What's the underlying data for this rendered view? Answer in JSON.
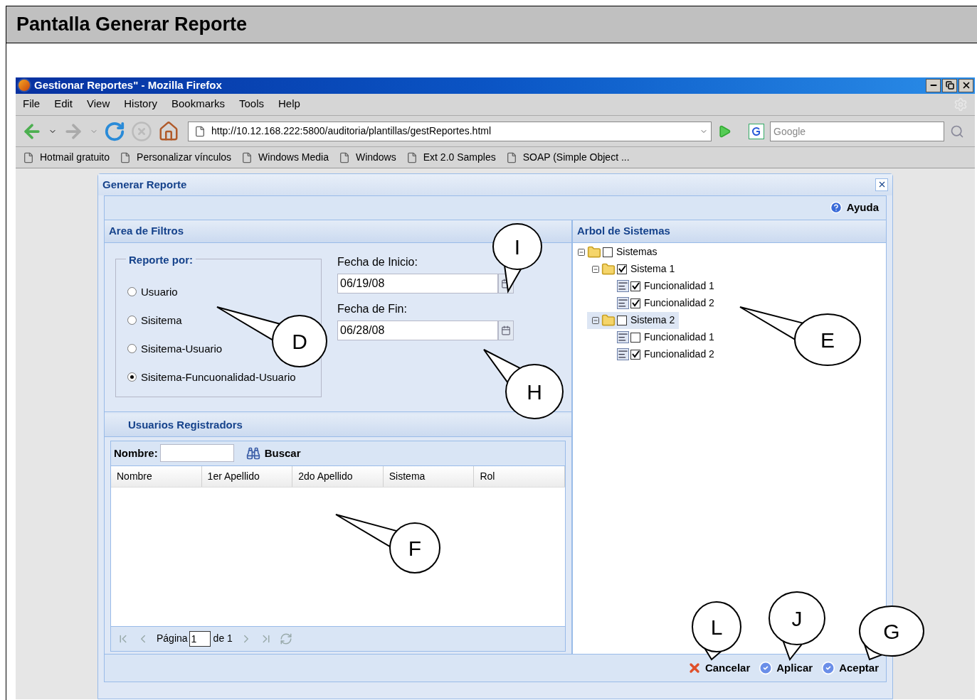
{
  "document": {
    "title": "Pantalla Generar Reporte"
  },
  "browser": {
    "title": "Gestionar Reportes\" - Mozilla Firefox",
    "menu": [
      "File",
      "Edit",
      "View",
      "History",
      "Bookmarks",
      "Tools",
      "Help"
    ],
    "url": "http://10.12.168.222:5800/auditoria/plantillas/gestReportes.html",
    "search": {
      "placeholder": "Google"
    },
    "bookmarks": [
      "Hotmail gratuito",
      "Personalizar vínculos",
      "Windows Media",
      "Windows",
      "Ext 2.0 Samples",
      "SOAP (Simple Object ..."
    ]
  },
  "dialog": {
    "title": "Generar Reporte",
    "help": "Ayuda",
    "filters": {
      "title": "Area de Filtros",
      "group": "Reporte por:",
      "options": [
        {
          "label": "Usuario",
          "selected": false
        },
        {
          "label": "Sisitema",
          "selected": false
        },
        {
          "label": "Sisitema-Usuario",
          "selected": false
        },
        {
          "label": "Sisitema-Funcuonalidad-Usuario",
          "selected": true
        }
      ],
      "start_label": "Fecha de Inicio:",
      "start_value": "06/19/08",
      "end_label": "Fecha de Fin:",
      "end_value": "06/28/08"
    },
    "users": {
      "title": "Usuarios Registradors",
      "search_label": "Nombre:",
      "search_button": "Buscar",
      "columns": [
        "Nombre",
        "1er Apellido",
        "2do Apellido",
        "Sistema",
        "Rol"
      ],
      "pager": {
        "page_label": "Página",
        "page": "1",
        "total": "de 1"
      }
    },
    "tree": {
      "title": "Arbol de Sistemas",
      "nodes": [
        {
          "label": "Sistemas",
          "checked": false,
          "selected": false,
          "expanded": true,
          "children": [
            {
              "label": "Sistema 1",
              "checked": true,
              "selected": false,
              "expanded": true,
              "children": [
                {
                  "label": "Funcionalidad 1",
                  "checked": true,
                  "selected": false
                },
                {
                  "label": "Funcionalidad 2",
                  "checked": true,
                  "selected": false
                }
              ]
            },
            {
              "label": "Sistema 2",
              "checked": false,
              "selected": true,
              "expanded": true,
              "children": [
                {
                  "label": "Funcionalidad 1",
                  "checked": false,
                  "selected": false
                },
                {
                  "label": "Funcionalidad 2",
                  "checked": true,
                  "selected": false
                }
              ]
            }
          ]
        }
      ]
    },
    "buttons": [
      {
        "label": "Cancelar",
        "kind": "cancel"
      },
      {
        "label": "Aplicar",
        "kind": "ok"
      },
      {
        "label": "Aceptar",
        "kind": "ok"
      }
    ]
  },
  "callouts": [
    {
      "label": "I"
    },
    {
      "label": "D"
    },
    {
      "label": "H"
    },
    {
      "label": "E"
    },
    {
      "label": "F"
    },
    {
      "label": "L"
    },
    {
      "label": "J"
    },
    {
      "label": "G"
    }
  ]
}
